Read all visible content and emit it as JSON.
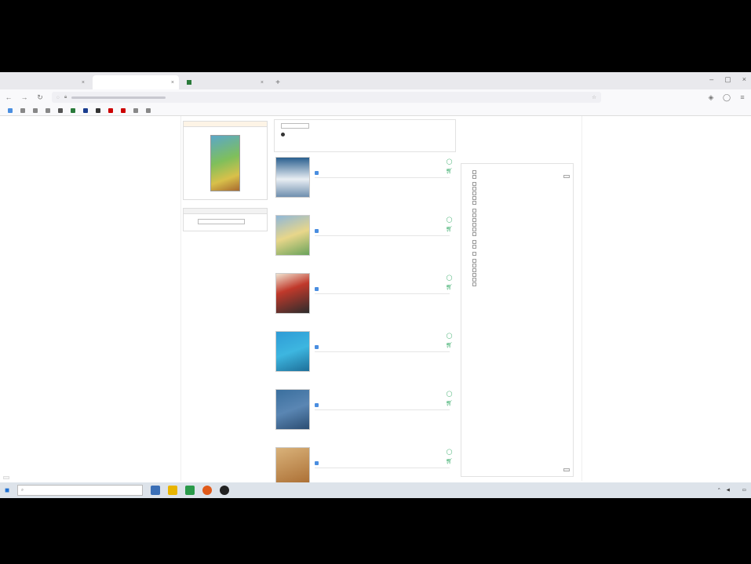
{
  "browser": {
    "tabs": [
      {
        "label": ""
      },
      {
        "label": ""
      },
      {
        "label": ""
      }
    ],
    "url": "",
    "bookmarks": [
      {
        "label": "",
        "color": "#4a8ee0"
      },
      {
        "label": "",
        "color": "#888888"
      },
      {
        "label": "",
        "color": "#888888"
      },
      {
        "label": "",
        "color": "#888888"
      },
      {
        "label": "",
        "color": "#555555"
      },
      {
        "label": "",
        "color": "#2a7a3a"
      },
      {
        "label": "",
        "color": "#1a3d8f"
      },
      {
        "label": "",
        "color": "#333333"
      },
      {
        "label": "",
        "color": "#cc0000"
      },
      {
        "label": "",
        "color": "#cc0000"
      },
      {
        "label": "",
        "color": "#888888"
      },
      {
        "label": "",
        "color": "#888888"
      }
    ]
  },
  "left": {
    "top_link": "",
    "box1_title": "",
    "box2_title": "",
    "box2_lines": [
      "",
      "",
      "",
      "",
      "",
      "",
      ""
    ]
  },
  "search": {
    "row1_label": "",
    "row1_link": "",
    "row2": "",
    "row3": "",
    "right_label": ""
  },
  "results_header": "",
  "results": [
    {
      "title": "",
      "author": "",
      "dispo": "",
      "meta": [
        "",
        "",
        ""
      ],
      "cover": "linear-gradient(180deg,#2a5f8f 0%,#e9eef3 55%,#6f8fae 100%)"
    },
    {
      "title": "",
      "author": "",
      "dispo": "",
      "meta": [
        "",
        "",
        ""
      ],
      "cover": "linear-gradient(160deg,#8fb7d9 0%,#e8d68a 50%,#6aa35b 100%)"
    },
    {
      "title": "",
      "author": "",
      "dispo": "",
      "meta": [
        "",
        "",
        ""
      ],
      "cover": "linear-gradient(160deg,#f0e2cf 0%,#c0392b 40%,#2c2c2c 100%)"
    },
    {
      "title": "",
      "author": "",
      "dispo": "",
      "meta": [
        "",
        "",
        ""
      ],
      "cover": "linear-gradient(160deg,#2e9bd6 0%,#3db6e0 50%,#1e6f99 100%)"
    },
    {
      "title": "",
      "author": "",
      "dispo": "",
      "meta": [
        "",
        "",
        ""
      ],
      "cover": "linear-gradient(160deg,#3a6f9e 0%,#5a86b3 50%,#2b4d72 100%)"
    },
    {
      "title": "",
      "author": "",
      "dispo": "",
      "meta": [
        "",
        "",
        ""
      ],
      "cover": "linear-gradient(160deg,#d9b27a 0%,#a86a2f 100%)"
    }
  ],
  "facets": {
    "title": "",
    "groups": [
      {
        "title": "",
        "items": [
          "",
          ""
        ]
      },
      {
        "title": "",
        "items": [
          "",
          "",
          "",
          "",
          ""
        ],
        "more": ""
      },
      {
        "title": "",
        "items": [
          "",
          "",
          "",
          "",
          "",
          ""
        ],
        "more": ""
      },
      {
        "title": "",
        "items": [
          "",
          ""
        ]
      },
      {
        "title": "",
        "items": [
          ""
        ]
      },
      {
        "title": "",
        "items": [
          "",
          "",
          "",
          "",
          "",
          ""
        ],
        "more": ""
      }
    ],
    "filter_label": ""
  },
  "status_tip": "",
  "taskbar": {
    "search_placeholder": "",
    "time": "",
    "date": ""
  }
}
